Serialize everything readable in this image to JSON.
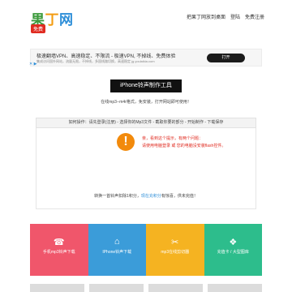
{
  "header": {
    "logo_part1": "果",
    "logo_part2": "丁",
    "logo_part3": "网",
    "badge": "免费",
    "nav": [
      "把果丁网放到桌面",
      "登陆",
      "免费注册"
    ]
  },
  "ad": {
    "title": "极速翻墙VPN、高速稳定、不限流 - 极速VPN, 不掉线、免费体验",
    "subtitle": "集成访问国外网站，流量无限，不掉线，多国线路切换，高速稳定 jg.youlaikia.com",
    "button": "打开",
    "mark": "✕ ▶"
  },
  "tool": {
    "title": "iPhone铃声制作工具",
    "subtitle": "在线mp3--m4r格式，免安装，打开网站即可使用！"
  },
  "steps": "如何操作：请先登录(注册) - 选择你的Mp3文件 - 截取你要的部分 - 开始制作 - 下载保存",
  "warning": {
    "icon": "!",
    "line1": "亲，看到这个提示，有两个问题：",
    "line2": "请使用电脑登录 或 您的电脑没安装flash控件。"
  },
  "note": {
    "before": "转换一首铃声扣除1积分，",
    "highlight": "现在充积分",
    "after": "有惊喜，供未完值！"
  },
  "tiles": [
    {
      "label": "手机mp3铃声下载",
      "icon": "☎",
      "color": "#f0566b"
    },
    {
      "label": "IPhone铃声下载",
      "icon": "⌂",
      "color": "#3b9cd9"
    },
    {
      "label": "mp3在线剪切器",
      "icon": "✂",
      "color": "#f5b321"
    },
    {
      "label": "充值卡 / 大型图库",
      "icon": "❖",
      "color": "#2dbd8c"
    }
  ]
}
